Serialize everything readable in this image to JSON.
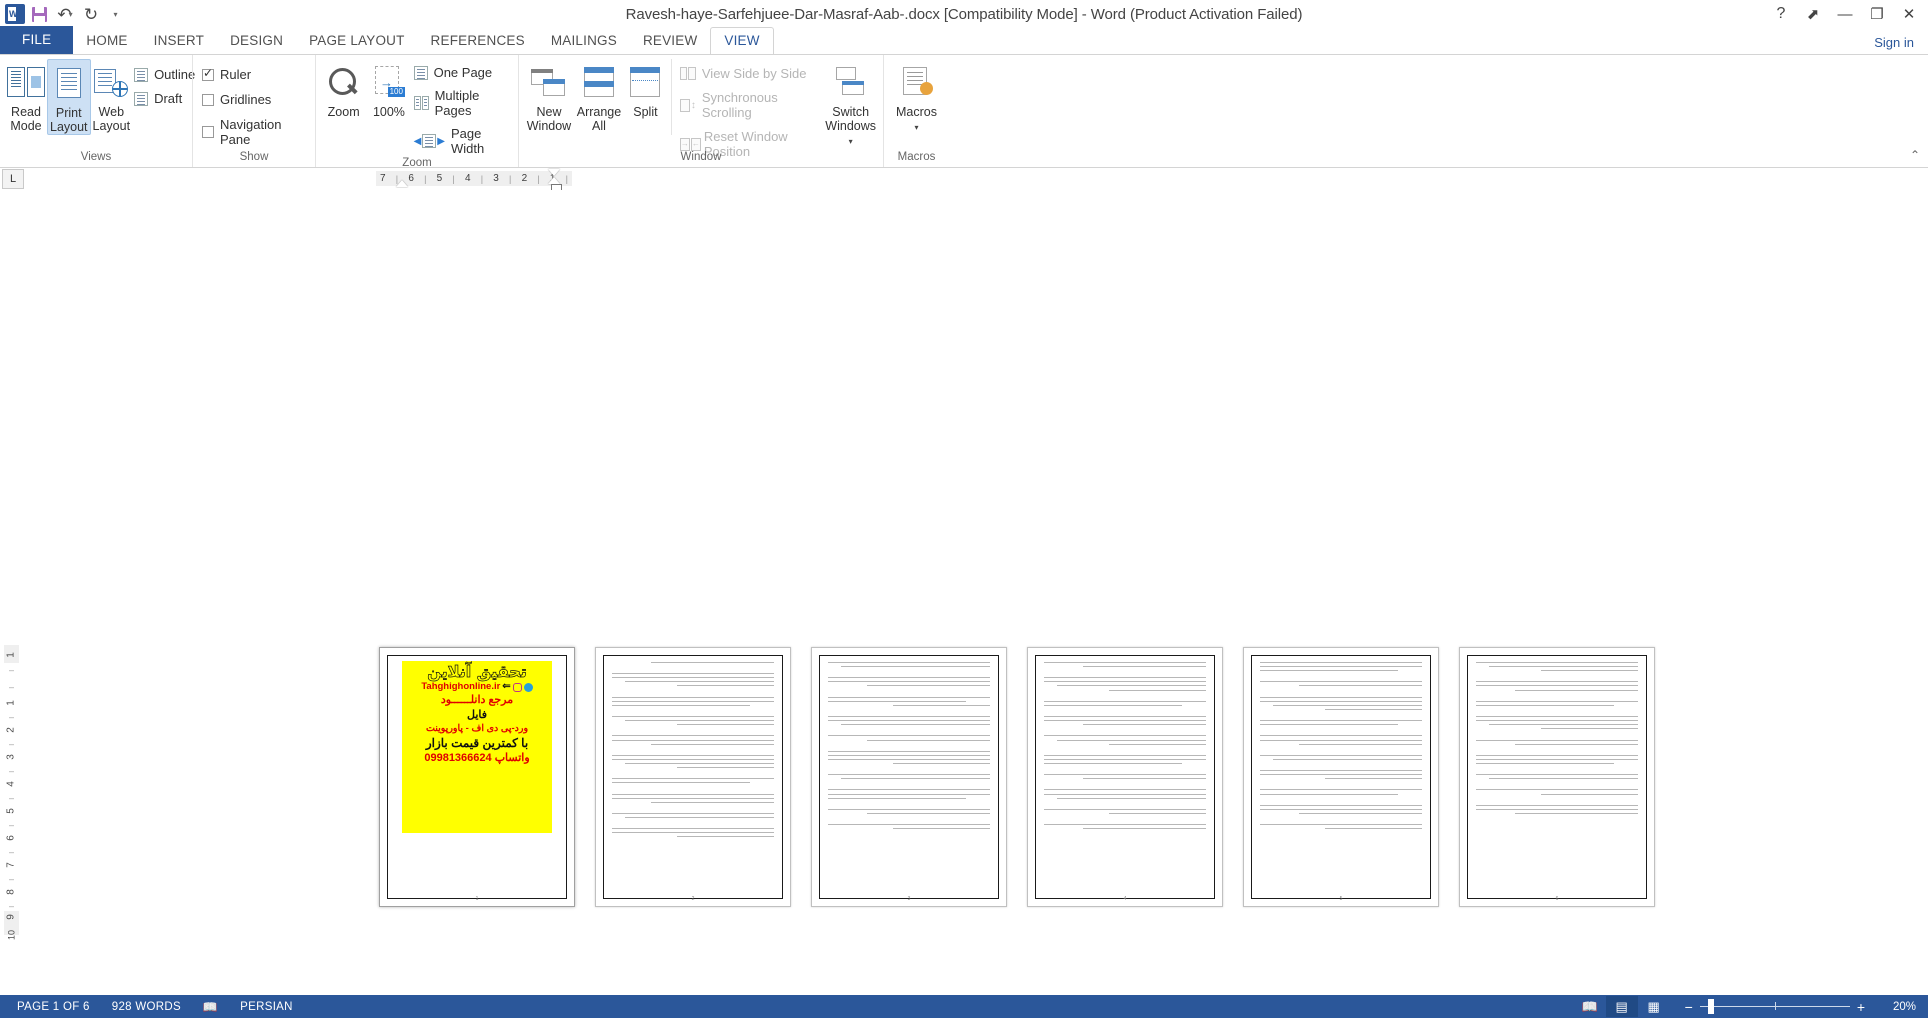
{
  "window": {
    "title": "Ravesh-haye-Sarfehjuee-Dar-Masraf-Aab-.docx [Compatibility Mode] - Word (Product Activation Failed)",
    "help_icon": "?",
    "ribbon_display_icon": "⬈",
    "minimize_icon": "—",
    "restore_icon": "❐",
    "close_icon": "✕"
  },
  "quick_access": {
    "app_icon": "word-logo",
    "app_letter": "W",
    "save_icon": "save-icon",
    "undo_icon": "↶",
    "undo_caret": "▾",
    "redo_icon": "↻",
    "customize_caret": "▾"
  },
  "tabs": [
    {
      "label": "FILE",
      "id": "file"
    },
    {
      "label": "HOME",
      "id": "home"
    },
    {
      "label": "INSERT",
      "id": "insert"
    },
    {
      "label": "DESIGN",
      "id": "design"
    },
    {
      "label": "PAGE LAYOUT",
      "id": "page-layout"
    },
    {
      "label": "REFERENCES",
      "id": "references"
    },
    {
      "label": "MAILINGS",
      "id": "mailings"
    },
    {
      "label": "REVIEW",
      "id": "review"
    },
    {
      "label": "VIEW",
      "id": "view"
    }
  ],
  "active_tab": "VIEW",
  "sign_in": "Sign in",
  "ribbon": {
    "collapse_icon": "⌃",
    "groups": [
      {
        "id": "views",
        "label": "Views"
      },
      {
        "id": "show",
        "label": "Show"
      },
      {
        "id": "zoom",
        "label": "Zoom"
      },
      {
        "id": "window",
        "label": "Window"
      },
      {
        "id": "macros",
        "label": "Macros"
      }
    ],
    "views": {
      "read_mode": "Read\nMode",
      "read_mode_l1": "Read",
      "read_mode_l2": "Mode",
      "print_layout_l1": "Print",
      "print_layout_l2": "Layout",
      "web_layout_l1": "Web",
      "web_layout_l2": "Layout",
      "outline": "Outline",
      "draft": "Draft"
    },
    "show": {
      "ruler": "Ruler",
      "ruler_checked": true,
      "gridlines": "Gridlines",
      "gridlines_checked": false,
      "navigation_pane": "Navigation Pane",
      "navigation_pane_checked": false
    },
    "zoom": {
      "zoom_label": "Zoom",
      "percent_label": "100%",
      "percent_badge": "100",
      "one_page": "One Page",
      "multiple_pages": "Multiple Pages",
      "page_width": "Page Width"
    },
    "window": {
      "new_window_l1": "New",
      "new_window_l2": "Window",
      "arrange_all_l1": "Arrange",
      "arrange_all_l2": "All",
      "split": "Split",
      "view_side_by_side": "View Side by Side",
      "synchronous_scrolling": "Synchronous Scrolling",
      "reset_window_position": "Reset Window Position",
      "switch_windows_l1": "Switch",
      "switch_windows_l2": "Windows",
      "switch_caret": "▾"
    },
    "macros": {
      "label_l1": "Macros",
      "caret": "▾"
    }
  },
  "ruler": {
    "corner_tab_stop": "L",
    "horizontal_ticks": [
      "7",
      "|",
      "6",
      "|",
      "5",
      "|",
      "4",
      "|",
      "3",
      "|",
      "2",
      "|",
      "1",
      "|"
    ],
    "vertical_ticks": [
      "1",
      "",
      "",
      "1",
      "2",
      "3",
      "4",
      "5",
      "6",
      "7",
      "8",
      "9",
      "10"
    ]
  },
  "document": {
    "page_count": 6,
    "zoom_percent": 20,
    "ad": {
      "line1": "تحقیق آنلاین",
      "line2": "Tahghighonline.ir",
      "line3": "مرجع دانلــــــود",
      "line4": "فایل",
      "line5": "ورد-پی دی اف - پاورپوینت",
      "line6": "با کمترین قیمت بازار",
      "line7": "واتساپ 09981366624"
    },
    "pages": [
      {
        "number": "1",
        "has_ad": true
      },
      {
        "number": "2",
        "has_ad": false
      },
      {
        "number": "3",
        "has_ad": false
      },
      {
        "number": "4",
        "has_ad": false
      },
      {
        "number": "5",
        "has_ad": false
      },
      {
        "number": "6",
        "has_ad": false
      }
    ]
  },
  "status_bar": {
    "page_info": "PAGE 1 OF 6",
    "word_count": "928 WORDS",
    "proofing_icon": "proofing-errors-icon",
    "language": "PERSIAN",
    "view_read_mode_icon": "read-mode-icon",
    "view_print_layout_icon": "print-layout-icon",
    "view_web_layout_icon": "web-layout-icon",
    "zoom_out_icon": "−",
    "zoom_in_icon": "+",
    "zoom_value": "20%"
  }
}
